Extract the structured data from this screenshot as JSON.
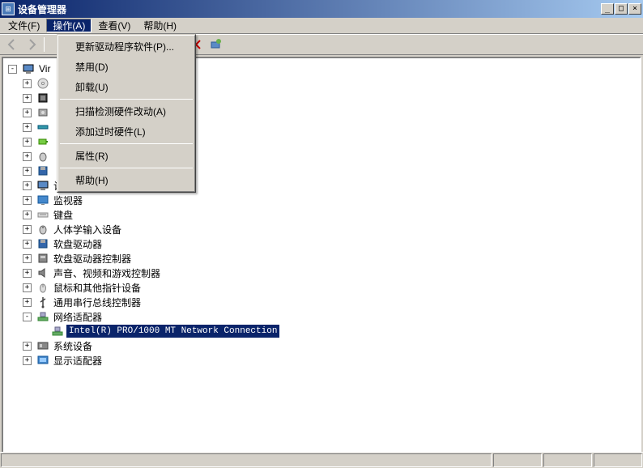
{
  "window": {
    "title": "设备管理器",
    "buttons": {
      "min": "_",
      "max": "□",
      "close": "×"
    }
  },
  "menubar": {
    "file": "文件(F)",
    "action": "操作(A)",
    "view": "查看(V)",
    "help": "帮助(H)"
  },
  "dropdown": {
    "update_driver": "更新驱动程序软件(P)...",
    "disable": "禁用(D)",
    "uninstall": "卸载(U)",
    "scan_hardware": "扫描检测硬件改动(A)",
    "add_legacy": "添加过时硬件(L)",
    "properties": "属性(R)",
    "help": "帮助(H)"
  },
  "toolbar": {
    "back": "←",
    "forward": "→"
  },
  "tree": {
    "root": "Vir",
    "items": [
      {
        "label": "",
        "icon": "dvd"
      },
      {
        "label": "",
        "icon": "cpu"
      },
      {
        "label": "",
        "icon": "disk"
      },
      {
        "label": "",
        "icon": "port"
      },
      {
        "label": "",
        "icon": "battery"
      },
      {
        "label": "",
        "icon": "hid"
      },
      {
        "label": "",
        "icon": "floppy"
      },
      {
        "label": "计算机",
        "icon": "computer"
      },
      {
        "label": "监视器",
        "icon": "monitor"
      },
      {
        "label": "键盘",
        "icon": "keyboard"
      },
      {
        "label": "人体学输入设备",
        "icon": "hid2"
      },
      {
        "label": "软盘驱动器",
        "icon": "floppy2"
      },
      {
        "label": "软盘驱动器控制器",
        "icon": "floppy-ctrl"
      },
      {
        "label": "声音、视频和游戏控制器",
        "icon": "sound"
      },
      {
        "label": "鼠标和其他指针设备",
        "icon": "mouse"
      },
      {
        "label": "通用串行总线控制器",
        "icon": "usb"
      },
      {
        "label": "网络适配器",
        "icon": "network",
        "expanded": true
      },
      {
        "label": "系统设备",
        "icon": "system"
      },
      {
        "label": "显示适配器",
        "icon": "display"
      }
    ],
    "selected_child": "Intel(R) PRO/1000 MT Network Connection"
  }
}
